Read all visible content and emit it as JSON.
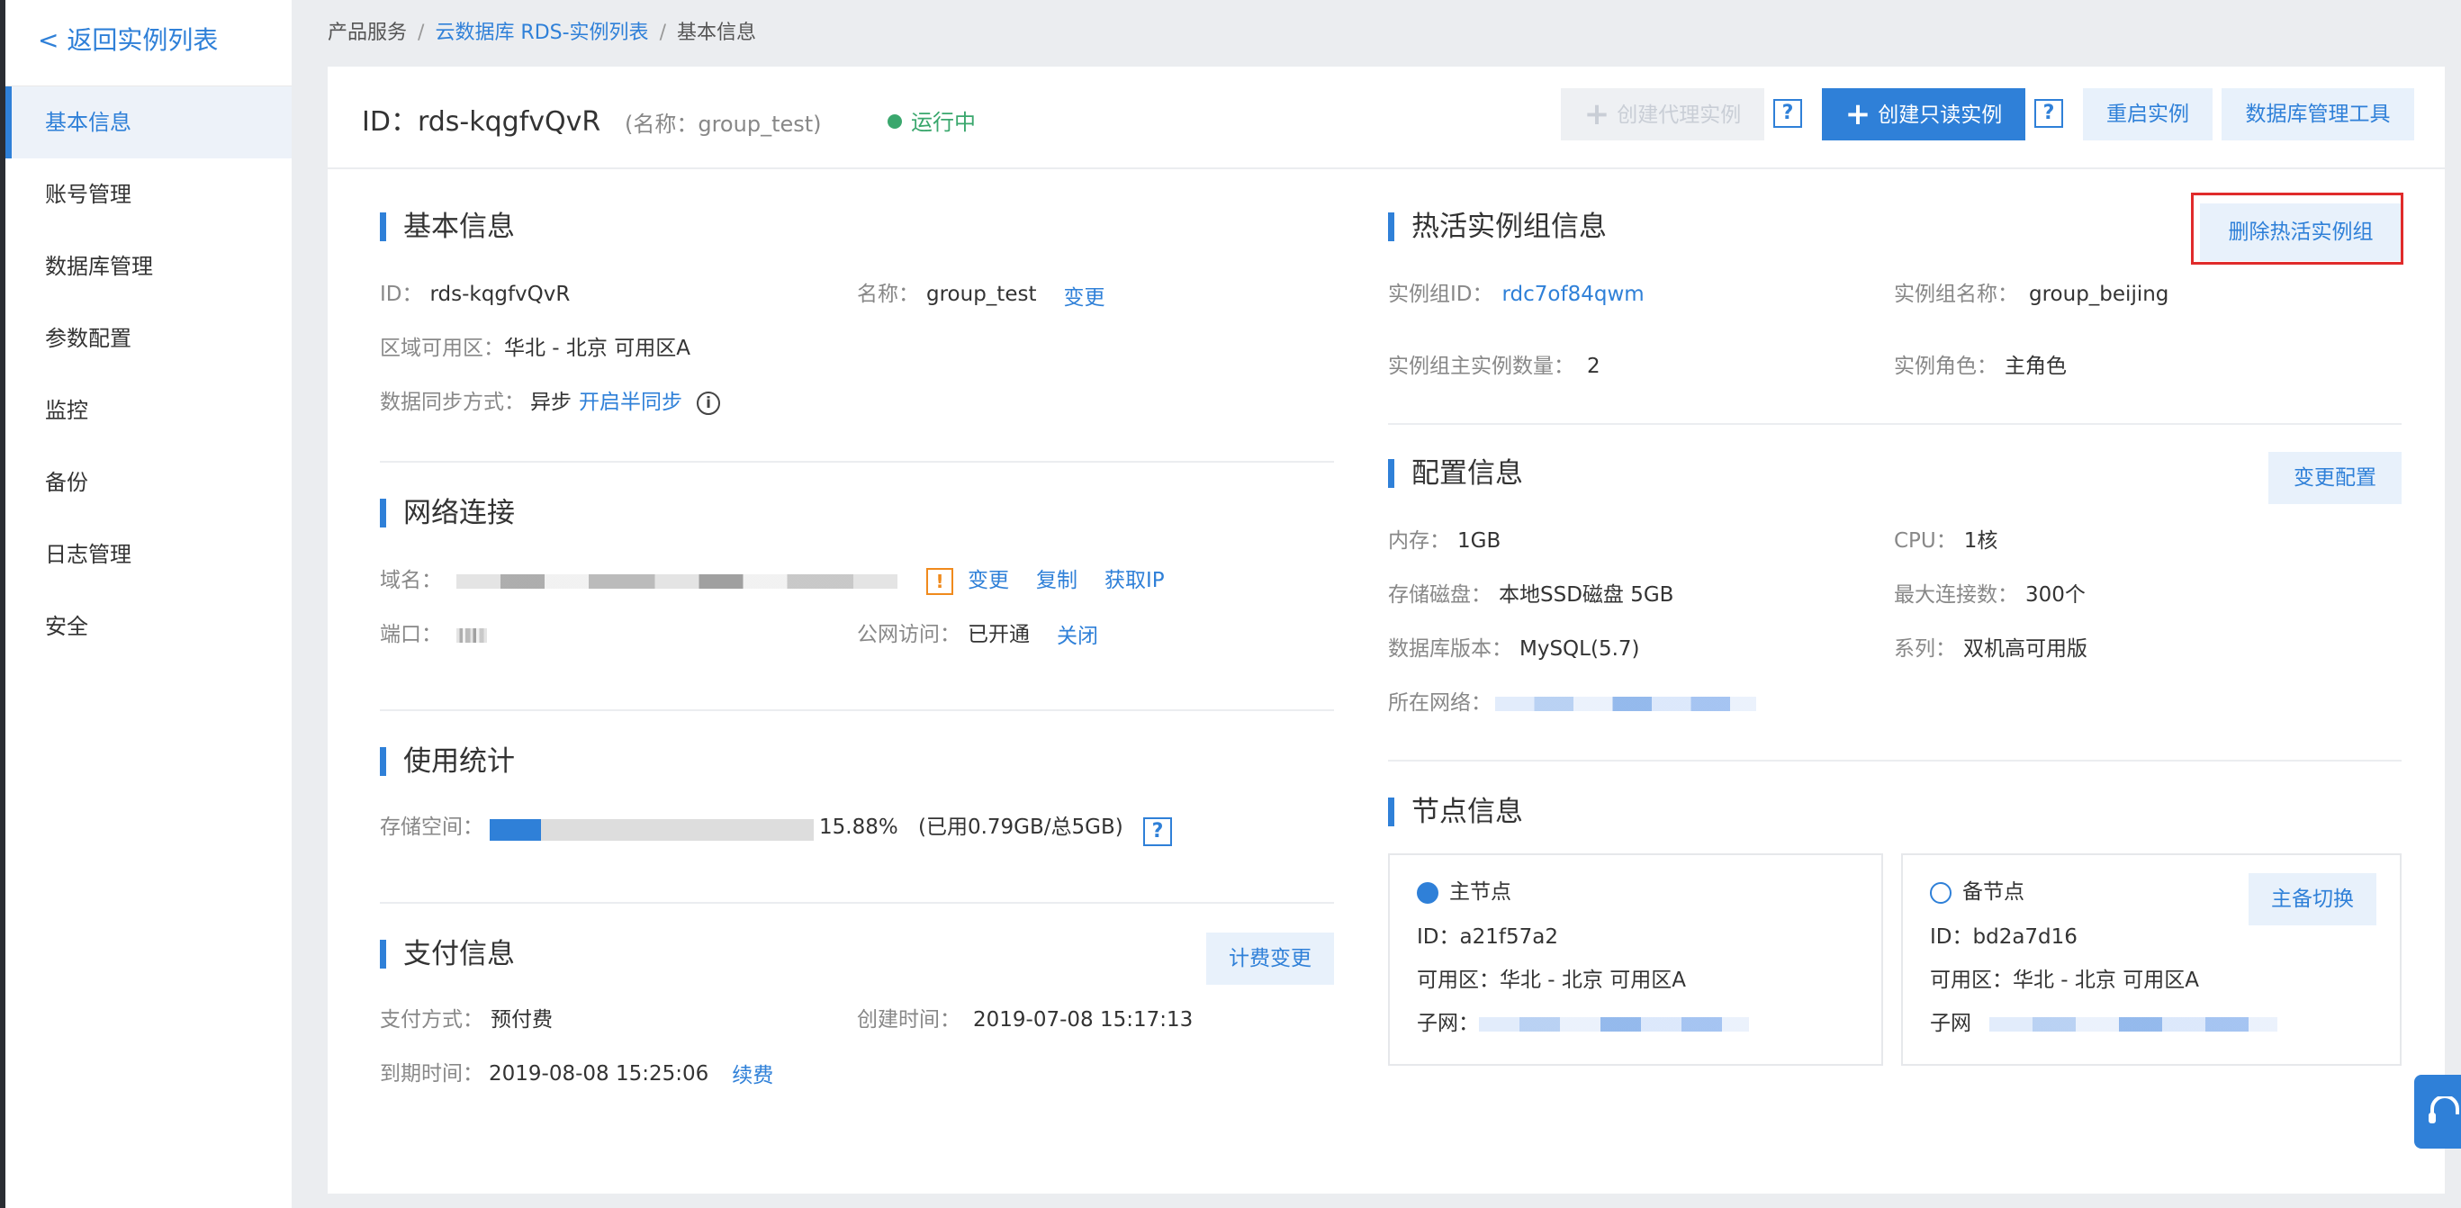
{
  "sidebar": {
    "back_label": "< 返回实例列表",
    "items": [
      {
        "label": "基本信息",
        "active": true
      },
      {
        "label": "账号管理"
      },
      {
        "label": "数据库管理"
      },
      {
        "label": "参数配置"
      },
      {
        "label": "监控"
      },
      {
        "label": "备份"
      },
      {
        "label": "日志管理"
      },
      {
        "label": "安全"
      }
    ]
  },
  "breadcrumb": {
    "root": "产品服务",
    "sep": "/",
    "list": "云数据库 RDS-实例列表",
    "current": "基本信息"
  },
  "header": {
    "instance_id": "ID：rds-kqgfvQvR",
    "instance_name": "(名称：group_test)",
    "status": "运行中",
    "buttons": {
      "create_proxy": "创建代理实例",
      "create_readonly": "创建只读实例",
      "restart": "重启实例",
      "db_tool": "数据库管理工具",
      "help": "?"
    }
  },
  "basic": {
    "title": "基本信息",
    "id_label": "ID：",
    "id_value": "rds-kqgfvQvR",
    "name_label": "名称：",
    "name_value": "group_test",
    "change": "变更",
    "zone_label": "区域可用区：",
    "zone_value": "华北 - 北京 可用区A",
    "sync_label": "数据同步方式：",
    "sync_value": "异步",
    "sync_link": "开启半同步",
    "info_icon": "i"
  },
  "network": {
    "title": "网络连接",
    "domain_label": "域名：",
    "warn": "!",
    "change": "变更",
    "copy": "复制",
    "get_ip": "获取IP",
    "port_label": "端口：",
    "public_label": "公网访问：",
    "public_value": "已开通",
    "close": "关闭"
  },
  "usage": {
    "title": "使用统计",
    "storage_label": "存储空间：",
    "percent_text": "15.88%",
    "progress": 0.1588,
    "detail": "(已用0.79GB/总5GB)",
    "help": "?"
  },
  "payment": {
    "title": "支付信息",
    "change_btn": "计费变更",
    "method_label": "支付方式：",
    "method_value": "预付费",
    "created_label": "创建时间：",
    "created_value": "2019-07-08 15:17:13",
    "expire_label": "到期时间：",
    "expire_value": "2019-08-08 15:25:06",
    "renew": "续费"
  },
  "hot_group": {
    "title": "热活实例组信息",
    "delete_btn": "删除热活实例组",
    "group_id_label": "实例组ID：",
    "group_id_value": "rdc7of84qwm",
    "group_name_label": "实例组名称：",
    "group_name_value": "group_beijing",
    "main_count_label": "实例组主实例数量：",
    "main_count_value": "2",
    "role_label": "实例角色：",
    "role_value": "主角色"
  },
  "config": {
    "title": "配置信息",
    "change_btn": "变更配置",
    "memory_label": "内存：",
    "memory_value": "1GB",
    "cpu_label": "CPU：",
    "cpu_value": "1核",
    "disk_label": "存储磁盘：",
    "disk_value": "本地SSD磁盘 5GB",
    "maxconn_label": "最大连接数：",
    "maxconn_value": "300个",
    "version_label": "数据库版本：",
    "version_value": "MySQL(5.7)",
    "series_label": "系列：",
    "series_value": "双机高可用版",
    "network_label": "所在网络："
  },
  "nodes": {
    "title": "节点信息",
    "primary": {
      "name": "主节点",
      "id": "ID：a21f57a2",
      "zone": "可用区：华北 - 北京 可用区A",
      "subnet_label": "子网："
    },
    "standby": {
      "name": "备节点",
      "switch_btn": "主备切换",
      "id": "ID：bd2a7d16",
      "zone": "可用区：华北 - 北京 可用区A",
      "subnet_label": "子网"
    }
  },
  "colors": {
    "accent": "#2f80d8",
    "running": "#3aa76d",
    "highlight": "#e02b2b"
  }
}
